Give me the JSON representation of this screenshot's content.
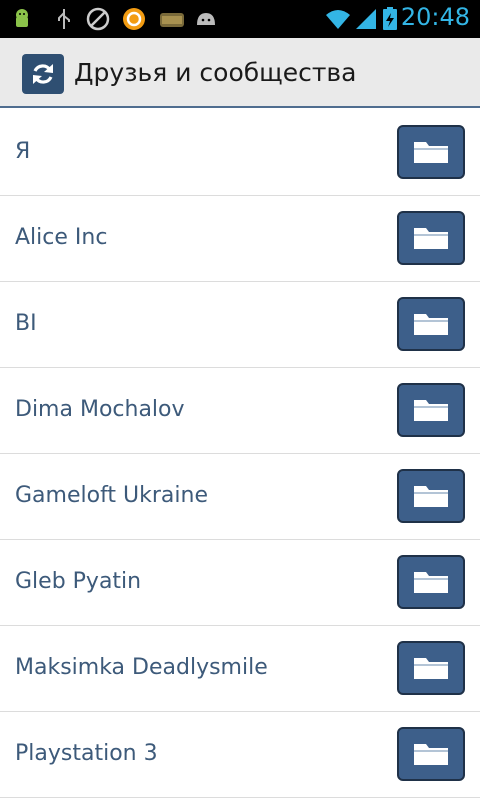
{
  "status_bar": {
    "time": "20:48",
    "icons": [
      "android-robot-icon",
      "usb-icon",
      "blocked-icon",
      "sync-app-icon",
      "meat-app-icon",
      "android-head-icon",
      "wifi-icon",
      "signal-icon",
      "battery-charging-icon"
    ]
  },
  "action_bar": {
    "title": "Друзья и сообщества",
    "refresh_icon": "refresh-icon"
  },
  "list": {
    "items": [
      {
        "label": "Я"
      },
      {
        "label": "Alice Inc"
      },
      {
        "label": "BI"
      },
      {
        "label": "Dima Mochalov"
      },
      {
        "label": "Gameloft Ukraine"
      },
      {
        "label": "Gleb Pyatin"
      },
      {
        "label": "Maksimka Deadlysmile"
      },
      {
        "label": "Playstation 3"
      }
    ],
    "item_icon": "folder-icon"
  },
  "colors": {
    "accent": "#33b5e5",
    "button": "#3d5f8a",
    "label": "#3d5a7a"
  }
}
